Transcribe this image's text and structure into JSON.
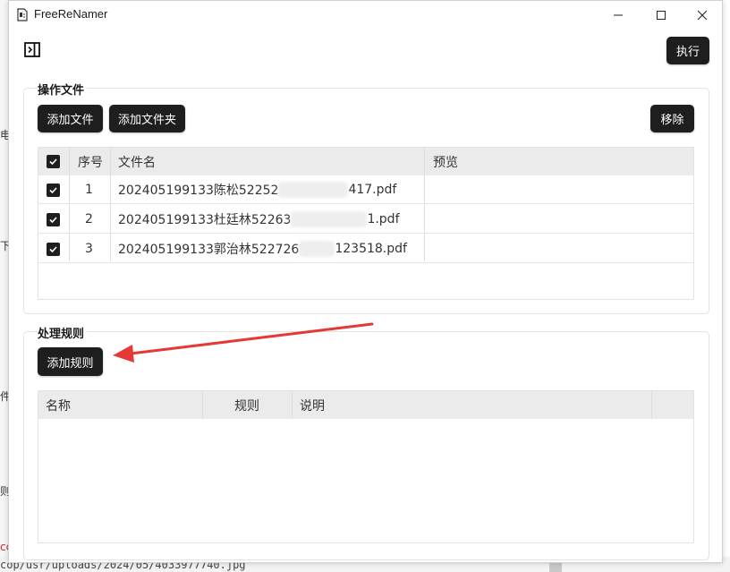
{
  "window": {
    "app_title": "FreeReNamer",
    "icons": {
      "app": "app-file-icon",
      "minimize": "minimize-icon",
      "maximize": "maximize-icon",
      "close": "close-icon",
      "sidebar": "sidebar-toggle-icon"
    }
  },
  "toolbar": {
    "execute_label": "执行"
  },
  "files_section": {
    "title": "操作文件",
    "add_file_label": "添加文件",
    "add_folder_label": "添加文件夹",
    "remove_label": "移除",
    "columns": {
      "index": "序号",
      "filename": "文件名",
      "preview": "预览"
    },
    "rows": [
      {
        "checked": true,
        "index": "1",
        "name_prefix": "202405199133陈松52252",
        "name_suffix": "417.pdf",
        "preview": ""
      },
      {
        "checked": true,
        "index": "2",
        "name_prefix": "202405199133杜廷林52263",
        "name_suffix": "1.pdf",
        "preview": ""
      },
      {
        "checked": true,
        "index": "3",
        "name_prefix": "202405199133郭治林522726",
        "name_suffix": "123518.pdf",
        "preview": ""
      }
    ]
  },
  "rules_section": {
    "title": "处理规则",
    "add_rule_label": "添加规则",
    "columns": {
      "name": "名称",
      "rule": "规则",
      "description": "说明"
    }
  },
  "background": {
    "left_chars": [
      "电",
      "下",
      "件",
      "则",
      "cc"
    ],
    "bottom_path": "cop/usr/uploads/2024/05/4033977740.jpg"
  },
  "colors": {
    "button_dark": "#1e1e1e",
    "header_bg": "#ebebeb",
    "arrow_red": "#e53935"
  }
}
